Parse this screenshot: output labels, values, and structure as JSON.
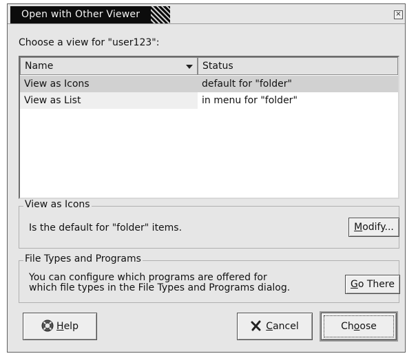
{
  "window": {
    "title": "Open with Other Viewer",
    "close_glyph": "×"
  },
  "prompt": "Choose a view for \"user123\":",
  "list": {
    "columns": [
      "Name",
      "Status"
    ],
    "rows": [
      {
        "name": "View as Icons",
        "status": "default for \"folder\"",
        "selected": true
      },
      {
        "name": "View as List",
        "status": "in menu for \"folder\"",
        "selected": false
      }
    ]
  },
  "view_group": {
    "title": "View as Icons",
    "text": "Is the default for \"folder\" items.",
    "button_mnemonic": "M",
    "button_rest": "odify..."
  },
  "filetypes_group": {
    "title": "File Types and Programs",
    "line1": "You can configure which programs are offered for",
    "line2": "which file types in the File Types and Programs dialog.",
    "button_mnemonic": "G",
    "button_rest": "o There"
  },
  "buttons": {
    "help": {
      "mnemonic": "H",
      "rest": "elp",
      "icon": "help-lifebuoy-icon"
    },
    "cancel": {
      "mnemonic": "C",
      "rest": "ancel",
      "icon": "cancel-x-icon"
    },
    "choose": {
      "pre": "Ch",
      "mnemonic": "o",
      "rest": "ose"
    }
  }
}
